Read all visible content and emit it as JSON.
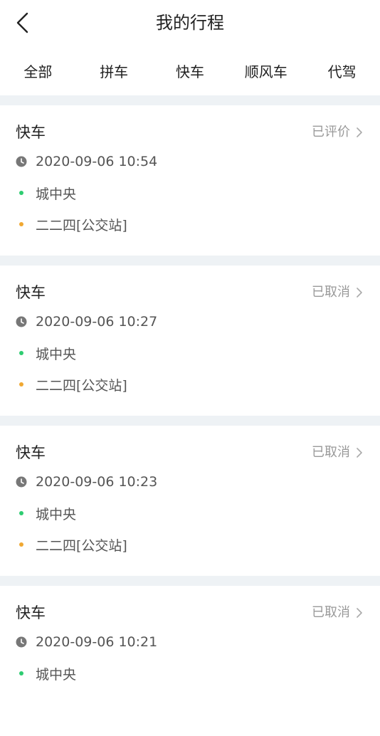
{
  "header": {
    "title": "我的行程"
  },
  "tabs": [
    {
      "label": "全部"
    },
    {
      "label": "拼车"
    },
    {
      "label": "快车"
    },
    {
      "label": "顺风车"
    },
    {
      "label": "代驾"
    }
  ],
  "colors": {
    "origin_dot": "#2ecc71",
    "destination_dot": "#f0a832",
    "separator": "#eef2f5"
  },
  "trips": [
    {
      "type": "快车",
      "status": "已评价",
      "time": "2020-09-06 10:54",
      "from": "城中央",
      "to": "二二四[公交站]"
    },
    {
      "type": "快车",
      "status": "已取消",
      "time": "2020-09-06 10:27",
      "from": "城中央",
      "to": "二二四[公交站]"
    },
    {
      "type": "快车",
      "status": "已取消",
      "time": "2020-09-06 10:23",
      "from": "城中央",
      "to": "二二四[公交站]"
    },
    {
      "type": "快车",
      "status": "已取消",
      "time": "2020-09-06 10:21",
      "from": "城中央",
      "to": ""
    }
  ]
}
